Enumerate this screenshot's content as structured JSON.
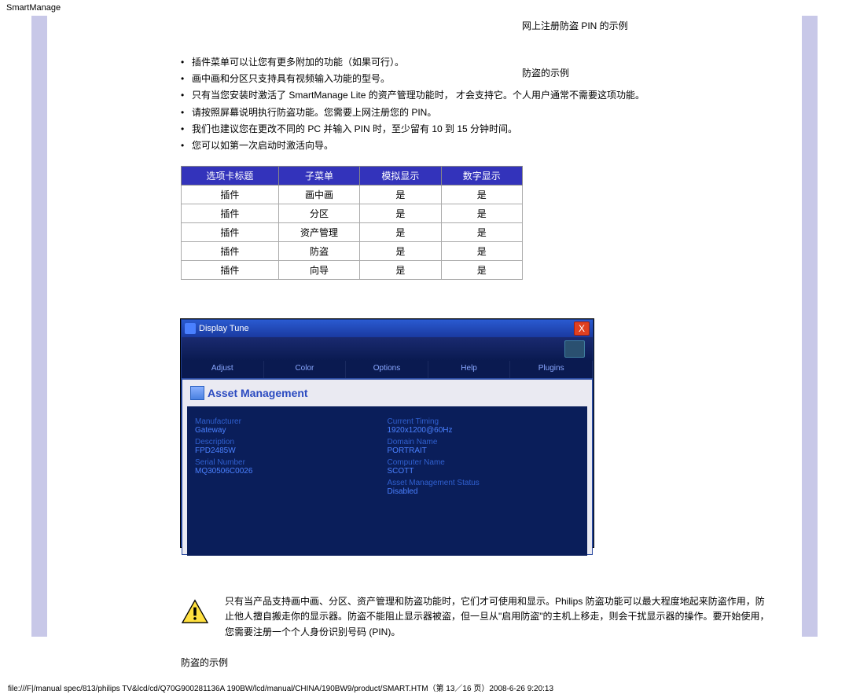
{
  "header": {
    "title": "SmartManage"
  },
  "links": {
    "pin_example": "网上注册防盗 PIN 的示例",
    "theft_example": "防盗的示例"
  },
  "bullets": [
    "插件菜单可以让您有更多附加的功能（如果可行）。",
    "画中画和分区只支持具有视频输入功能的型号。",
    "只有当您安装时激活了 SmartManage Lite 的资产管理功能时， 才会支持它。个人用户通常不需要这项功能。",
    "请按照屏幕说明执行防盗功能。您需要上网注册您的 PIN。",
    "我们也建议您在更改不同的 PC 并输入 PIN 时，至少留有 10 到 15 分钟时间。",
    "您可以如第一次启动时激活向导。"
  ],
  "table": {
    "headers": [
      "选项卡标题",
      "子菜单",
      "模拟显示",
      "数字显示"
    ],
    "rows": [
      [
        "插件",
        "画中画",
        "是",
        "是"
      ],
      [
        "插件",
        "分区",
        "是",
        "是"
      ],
      [
        "插件",
        "资产管理",
        "是",
        "是"
      ],
      [
        "插件",
        "防盗",
        "是",
        "是"
      ],
      [
        "插件",
        "向导",
        "是",
        "是"
      ]
    ]
  },
  "dtune": {
    "title": "Display Tune",
    "close": "X",
    "tabs": [
      "Adjust",
      "Color",
      "Options",
      "Help",
      "Plugins"
    ],
    "panel_title": "Asset Management",
    "left_fields": [
      {
        "label": "Manufacturer",
        "value": "Gateway"
      },
      {
        "label": "Description",
        "value": "FPD2485W"
      },
      {
        "label": "Serial Number",
        "value": "MQ30506C0026"
      }
    ],
    "right_fields": [
      {
        "label": "Current Timing",
        "value": "1920x1200@60Hz"
      },
      {
        "label": "Domain Name",
        "value": "PORTRAIT"
      },
      {
        "label": "Computer Name",
        "value": "SCOTT"
      },
      {
        "label": "Asset Management Status",
        "value": "Disabled"
      }
    ]
  },
  "note_text": "只有当产品支持画中画、分区、资产管理和防盗功能时，它们才可使用和显示。Philips 防盗功能可以最大程度地起来防盗作用，防止他人擅自搬走你的显示器。防盗不能阻止显示器被盗，但一旦从\"启用防盗\"的主机上移走，则会干扰显示器的操作。要开始使用，您需要注册一个个人身份识别号码 (PIN)。",
  "section_label": "防盗的示例",
  "footer": "file:///F|/manual spec/813/philips TV&lcd/cd/Q70G900281136A 190BW/lcd/manual/CHINA/190BW9/product/SMART.HTM（第 13／16 页）2008-6-26 9:20:13"
}
